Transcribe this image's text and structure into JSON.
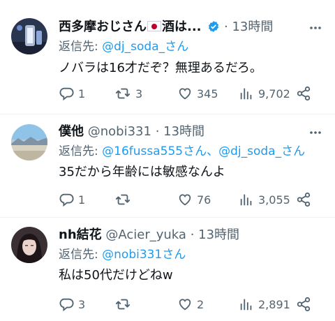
{
  "colors": {
    "accent": "#1d9bf0",
    "muted": "#536471",
    "text": "#0f1419",
    "verified": "#1d9bf0"
  },
  "tweets": [
    {
      "name": "西多摩おじさん",
      "name_suffix": "酒は...",
      "handle": "",
      "dot": "·",
      "time": "13時間",
      "verified": true,
      "flag_emoji": "jp-flag",
      "reply_prefix": "返信先: ",
      "reply_to": "@dj_soda_さん",
      "text": "ノバラは16才だぞ？無理あるだろ。",
      "replies": "1",
      "retweets": "3",
      "likes": "345",
      "views": "9,702"
    },
    {
      "name": "僕他",
      "name_suffix": "",
      "handle": "@nobi331",
      "dot": "·",
      "time": "13時間",
      "verified": false,
      "reply_prefix": "返信先: ",
      "reply_to": "@16fussa555さん、@dj_soda_さん",
      "text": "35だから年齢には敏感なんよ",
      "replies": "1",
      "retweets": "",
      "likes": "76",
      "views": "3,055"
    },
    {
      "name": "nh結花",
      "name_suffix": "",
      "handle": "@Acier_yuka",
      "dot": "·",
      "time": "13時間",
      "verified": false,
      "reply_prefix": "返信先: ",
      "reply_to": "@nobi331さん",
      "text": "私は50代だけどねw",
      "replies": "3",
      "retweets": "",
      "likes": "2",
      "views": "2,891"
    }
  ]
}
